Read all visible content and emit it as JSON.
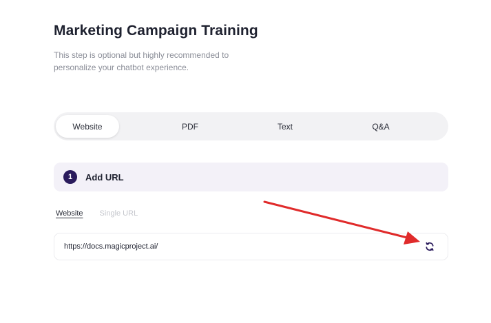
{
  "header": {
    "title": "Marketing Campaign Training",
    "subtitle_line1": "This step is optional but highly recommended to",
    "subtitle_line2": "personalize your chatbot experience."
  },
  "tabs": [
    {
      "label": "Website",
      "active": true
    },
    {
      "label": "PDF",
      "active": false
    },
    {
      "label": "Text",
      "active": false
    },
    {
      "label": "Q&A",
      "active": false
    }
  ],
  "step": {
    "number": "1",
    "label": "Add URL"
  },
  "source_tabs": [
    {
      "label": "Website",
      "active": true
    },
    {
      "label": "Single URL",
      "active": false
    }
  ],
  "url_field": {
    "value": "https://docs.magicproject.ai/"
  },
  "icons": {
    "refresh": "refresh-icon",
    "annotation": "red-arrow-annotation"
  },
  "colors": {
    "accent": "#2a1b5c",
    "annotation_arrow": "#e02b2b",
    "step_background": "#f3f1f8",
    "tabs_background": "#f2f2f4"
  }
}
